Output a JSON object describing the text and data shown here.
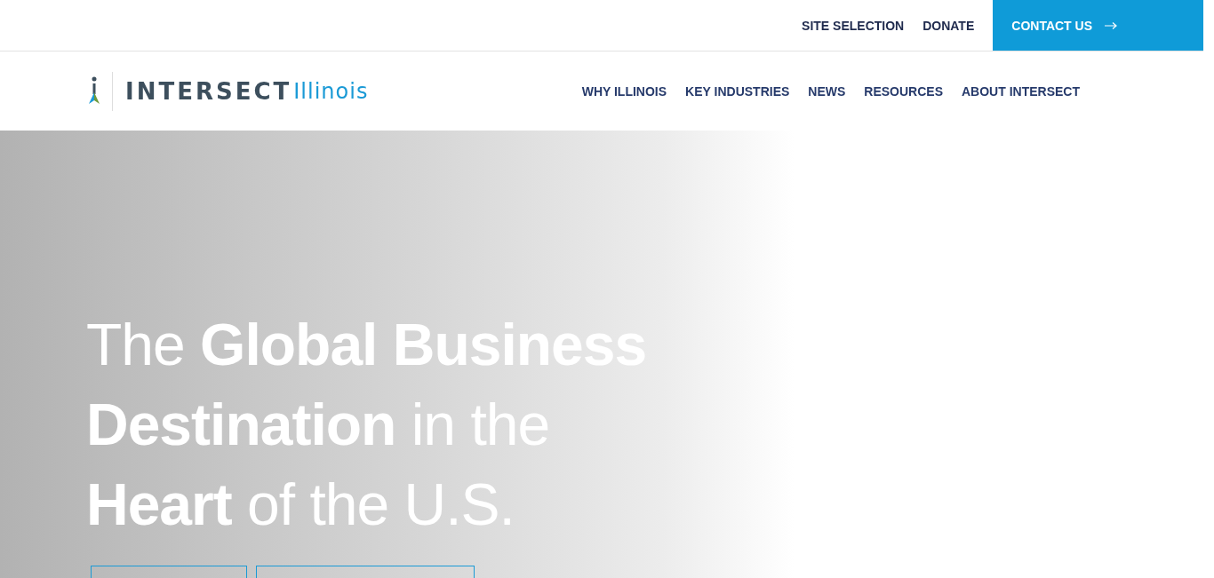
{
  "utility_nav": {
    "links": [
      "SITE SELECTION",
      "DONATE"
    ],
    "contact_button": "CONTACT US"
  },
  "logo": {
    "brand": "INTERSECT",
    "region": "Illinois"
  },
  "main_nav": [
    "WHY ILLINOIS",
    "KEY INDUSTRIES",
    "NEWS",
    "RESOURCES",
    "ABOUT INTERSECT"
  ],
  "hero": {
    "headline": "The **Global Business Destination** in the **Heart** of the U.S.",
    "buttons": [
      {
        "kind": "outline"
      },
      {
        "kind": "outline"
      }
    ]
  }
}
